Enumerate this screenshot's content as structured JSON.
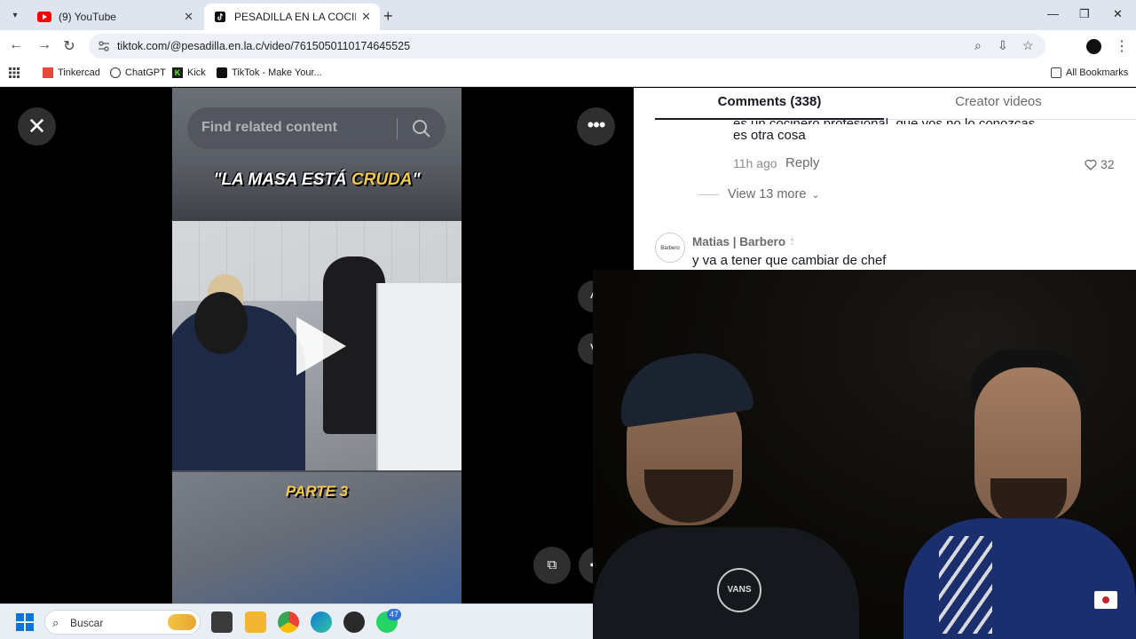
{
  "browser": {
    "tabs": [
      {
        "title": "(9) YouTube",
        "active": false,
        "favicon": "youtube-icon"
      },
      {
        "title": "PESADILLA EN LA COCINA (@p",
        "active": true,
        "favicon": "tiktok-icon"
      }
    ],
    "url": "tiktok.com/@pesadilla.en.la.c/video/7615050110174645525",
    "bookmarks": [
      {
        "label": "Tinkercad",
        "icon": "tinkercad-icon"
      },
      {
        "label": "ChatGPT",
        "icon": "chatgpt-icon"
      },
      {
        "label": "Kick",
        "icon": "kick-icon"
      },
      {
        "label": "TikTok - Make Your...",
        "icon": "tiktok-icon"
      }
    ],
    "all_bookmarks": "All Bookmarks"
  },
  "video": {
    "search_placeholder": "Find related content",
    "caption_top_pre": "\"LA MASA ESTÁ ",
    "caption_top_highlight": "CRUDA",
    "caption_top_post": "\"",
    "caption_bottom": "PARTE 3"
  },
  "comments": {
    "tab_comments": "Comments (338)",
    "tab_creator": "Creator videos",
    "reply_text_line1": "es un cocinero profesional, que vos no lo conozcas",
    "reply_text_line2": "es otra cosa",
    "reply_time": "11h ago",
    "reply_action": "Reply",
    "reply_likes": "32",
    "view_more": "View 13 more",
    "comment2": {
      "user": "Matias | Barbero",
      "avatar_text": "Barbero",
      "text": "y va a tener que cambiar de chef"
    }
  },
  "webcam": {
    "shirt_logo": "VANS"
  },
  "taskbar": {
    "search_label": "Buscar",
    "whatsapp_badge": "47"
  },
  "colors": {
    "tab_strip": "#dfe5ee",
    "caption_highlight": "#f2c94c",
    "accent_blue": "#0a74d8"
  }
}
